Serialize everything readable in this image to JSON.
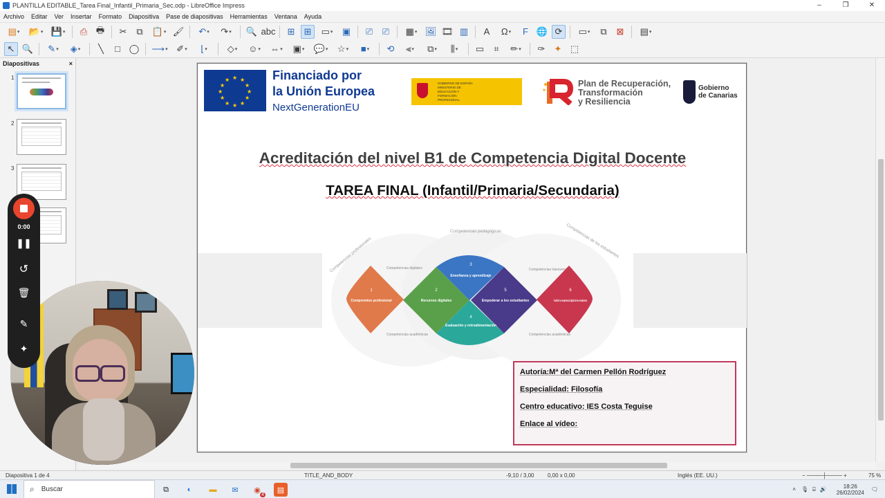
{
  "window": {
    "title": "PLANTILLA EDITABLE_Tarea Final_Infantil_Primaria_Sec.odp - LibreOffice Impress",
    "buttons": [
      "–",
      "❐",
      "✕"
    ]
  },
  "menu": [
    "Archivo",
    "Editar",
    "Ver",
    "Insertar",
    "Formato",
    "Diapositiva",
    "Pase de diapositivas",
    "Herramientas",
    "Ventana",
    "Ayuda"
  ],
  "sidepanel": {
    "title": "Diapositivas",
    "close": "×",
    "slides": [
      {
        "num": "1"
      },
      {
        "num": "2"
      },
      {
        "num": "3"
      },
      {
        "num": "4"
      }
    ]
  },
  "slide": {
    "eu_line1": "Financiado por",
    "eu_line2": "la Unión Europea",
    "eu_line3": "NextGenerationEU",
    "gob_es_text": "GOBIERNO DE ESPAÑA   MINISTERIO DE EDUCACIÓN Y FORMACIÓN PROFESIONAL",
    "prtr_line1": "Plan de Recuperación,",
    "prtr_line2": "Transformación",
    "prtr_line3": "y Resiliencia",
    "canarias_line1": "Gobierno",
    "canarias_line2": "de Canarias",
    "title": "Acreditación del nivel B1 de Competencia Digital Docente",
    "subtitle": "TAREA FINAL (Infantil/Primaria/Secundaria)",
    "diagram": {
      "arc_labels": [
        "Competencias profesionales",
        "Competencias pedagógicas",
        "Competencias de los estudiantes"
      ],
      "side_labels": [
        "Competencias digitales",
        "Competencias académicas",
        "Competencias transversales",
        "Competencias académicas"
      ],
      "areas": [
        {
          "num": "1",
          "label": "Compromiso profesional",
          "color": "#e07a4a"
        },
        {
          "num": "2",
          "label": "Recursos digitales",
          "color": "#5aa04a"
        },
        {
          "num": "3",
          "label": "Enseñanza y aprendizaje",
          "color": "#3a76c4"
        },
        {
          "num": "4",
          "label": "Evaluación y retroalimentación",
          "color": "#2aa89a"
        },
        {
          "num": "5",
          "label": "Empoderar a los estudiantes",
          "color": "#4a3a8a"
        },
        {
          "num": "6",
          "label": "Facilitar la competencia digital de los estudiantes",
          "color": "#c8374e"
        }
      ]
    },
    "author": {
      "autoria": "Autoría:Mª del Carmen Pellón Rodríguez",
      "especialidad": "Especialidad: Filosofía",
      "centro": "Centro educativo: IES Costa Teguise",
      "enlace": "Enlace al vídeo:"
    }
  },
  "statusbar": {
    "slide": "Diapositiva 1 de 4",
    "layout": "TITLE_AND_BODY",
    "position": "-9,10 / 3,00",
    "size": "0,00 x 0,00",
    "language": "Inglés (EE. UU.)",
    "zoom": "75 %"
  },
  "recorder": {
    "time": "0:00"
  },
  "taskbar": {
    "search_placeholder": "Buscar",
    "time": "18:26",
    "date": "26/02/2024",
    "badge": "4"
  }
}
